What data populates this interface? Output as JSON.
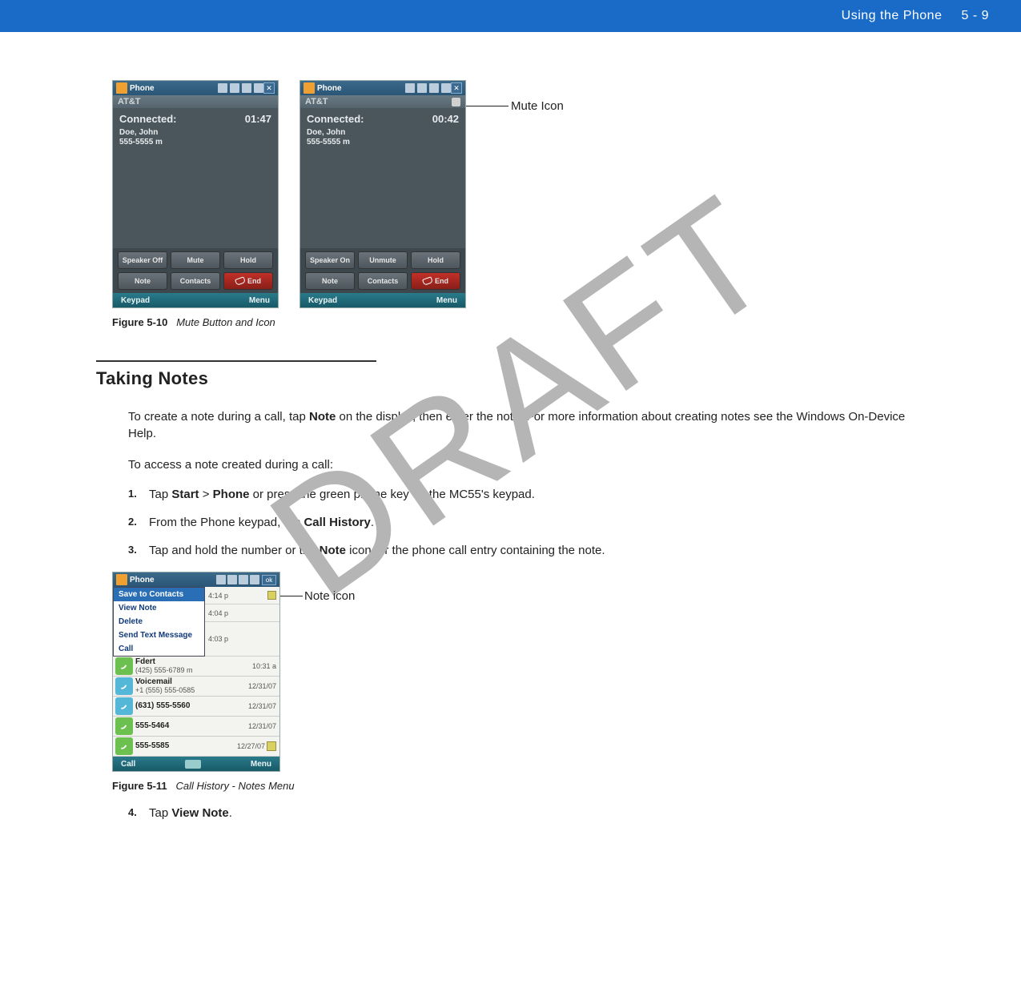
{
  "header": {
    "title": "Using the Phone",
    "page": "5 - 9"
  },
  "watermark": "DRAFT",
  "callouts": {
    "mute_icon": "Mute Icon",
    "note_icon": "Note icon"
  },
  "phones": {
    "left": {
      "window_title": "Phone",
      "carrier": "AT&T",
      "status_label": "Connected:",
      "timer": "01:47",
      "caller_name": "Doe, John",
      "caller_num": "555-5555 m",
      "buttons": [
        "Speaker Off",
        "Mute",
        "Hold",
        "Note",
        "Contacts",
        "End"
      ],
      "bottom_left": "Keypad",
      "bottom_right": "Menu"
    },
    "right": {
      "window_title": "Phone",
      "carrier": "AT&T",
      "status_label": "Connected:",
      "timer": "00:42",
      "caller_name": "Doe, John",
      "caller_num": "555-5555 m",
      "buttons": [
        "Speaker On",
        "Unmute",
        "Hold",
        "Note",
        "Contacts",
        "End"
      ],
      "bottom_left": "Keypad",
      "bottom_right": "Menu"
    }
  },
  "figure10": {
    "label": "Figure 5-10",
    "caption": "Mute Button and Icon"
  },
  "section": {
    "title": "Taking Notes",
    "p1_a": "To create a note during a call, tap ",
    "p1_bold": "Note",
    "p1_b": " on the display, then enter the note. For more information about creating notes see the Windows On-Device Help.",
    "p2": "To access a note created during a call:",
    "steps": {
      "s1_a": "Tap ",
      "s1_b1": "Start",
      "s1_gt": " > ",
      "s1_b2": "Phone",
      "s1_c": " or press the green phone key on the MC55's keypad.",
      "s2_a": "From the Phone keypad, tap ",
      "s2_b": "Call History",
      "s2_c": ".",
      "s3_a": "Tap and hold the number or the ",
      "s3_b": "Note",
      "s3_c": " icon for the phone call entry containing the note.",
      "s4_a": "Tap ",
      "s4_b": "View Note",
      "s4_c": "."
    }
  },
  "history": {
    "window_title": "Phone",
    "ok": "ok",
    "context_menu": [
      "Save to Contacts",
      "View Note",
      "Delete",
      "Send Text Message",
      "Call"
    ],
    "side_times": [
      "4:14 p",
      "4:04 p",
      "4:03 p"
    ],
    "rows": [
      {
        "name": "Fdert",
        "sub": "(425) 555-6789 m",
        "time": "10:31 a"
      },
      {
        "name": "Voicemail",
        "sub": "+1 (555) 555-0585",
        "time": "12/31/07"
      },
      {
        "name": "(631) 555-5560",
        "sub": "",
        "time": "12/31/07"
      },
      {
        "name": "555-5464",
        "sub": "",
        "time": "12/31/07"
      },
      {
        "name": "555-5585",
        "sub": "",
        "time": "12/27/07"
      }
    ],
    "bottom_left": "Call",
    "bottom_right": "Menu"
  },
  "figure11": {
    "label": "Figure 5-11",
    "caption": "Call History - Notes Menu"
  }
}
